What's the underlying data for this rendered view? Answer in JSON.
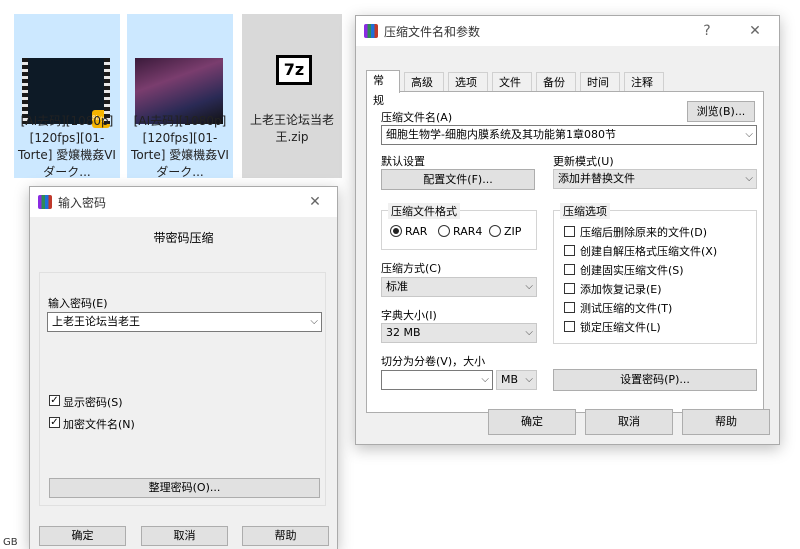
{
  "files": [
    {
      "name": "[AI去码][1080p][120fps][01-Torte] 愛嬢機姦VI ダーク...",
      "badge": "Player"
    },
    {
      "name": "[AI去码][1080p][120fps][01-Torte] 愛嬢機姦VI ダーク..."
    },
    {
      "name": "上老王论坛当老王.zip",
      "icon_text": "7z"
    }
  ],
  "archive_dialog": {
    "title": "压缩文件名和参数",
    "help_glyph": "?",
    "close_glyph": "✕",
    "tabs": [
      "常规",
      "高级",
      "选项",
      "文件",
      "备份",
      "时间",
      "注释"
    ],
    "archive_name_label": "压缩文件名(A)",
    "browse_button": "浏览(B)...",
    "archive_name_value": "细胞生物学-细胞内膜系统及其功能第1章080节",
    "default_settings_label": "默认设置",
    "profiles_button": "配置文件(F)...",
    "update_mode_label": "更新模式(U)",
    "update_mode_value": "添加并替换文件",
    "format_group": "压缩文件格式",
    "formats": [
      "RAR",
      "RAR4",
      "ZIP"
    ],
    "format_selected": "RAR",
    "method_label": "压缩方式(C)",
    "method_value": "标准",
    "dict_label": "字典大小(I)",
    "dict_value": "32 MB",
    "split_label": "切分为分卷(V)，大小",
    "split_value": "",
    "split_unit": "MB",
    "options_group": "压缩选项",
    "options": [
      {
        "label": "压缩后删除原来的文件(D)",
        "checked": false
      },
      {
        "label": "创建自解压格式压缩文件(X)",
        "checked": false
      },
      {
        "label": "创建固实压缩文件(S)",
        "checked": false
      },
      {
        "label": "添加恢复记录(E)",
        "checked": false
      },
      {
        "label": "测试压缩的文件(T)",
        "checked": false
      },
      {
        "label": "锁定压缩文件(L)",
        "checked": false
      }
    ],
    "set_password_button": "设置密码(P)...",
    "ok_button": "确定",
    "cancel_button": "取消",
    "help_button": "帮助"
  },
  "password_dialog": {
    "title": "输入密码",
    "close_glyph": "✕",
    "heading": "带密码压缩",
    "enter_password_label": "输入密码(E)",
    "password_value": "上老王论坛当老王",
    "show_password_label": "显示密码(S)",
    "show_password_checked": true,
    "encrypt_names_label": "加密文件名(N)",
    "encrypt_names_checked": true,
    "organize_button": "整理密码(O)...",
    "ok_button": "确定",
    "cancel_button": "取消",
    "help_button": "帮助"
  },
  "status_text": "GB"
}
